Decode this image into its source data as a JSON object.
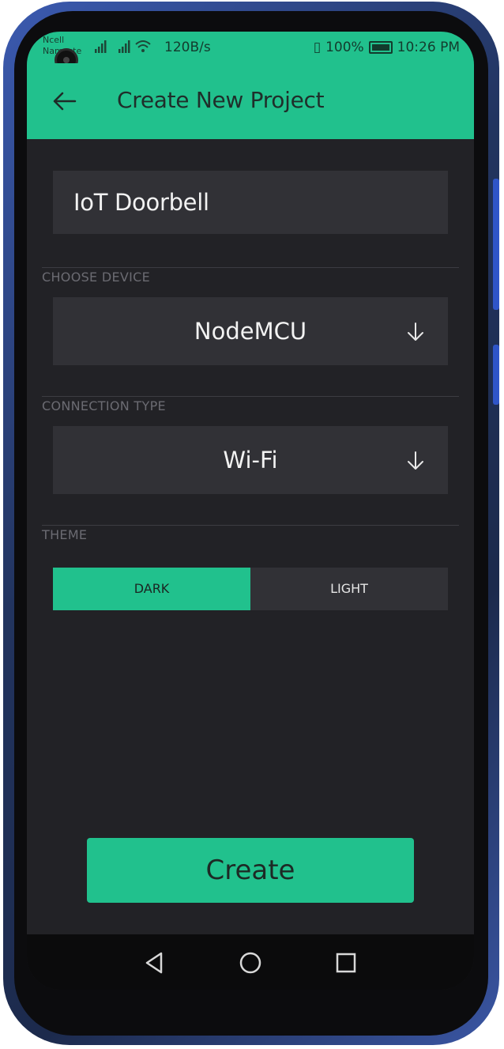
{
  "status_bar": {
    "carrier_line1": "Ncell",
    "carrier_line2": "Namaste",
    "net_speed": "120B/s",
    "battery": "100%",
    "time": "10:26 PM"
  },
  "app_bar": {
    "title": "Create New Project"
  },
  "form": {
    "project_name": "IoT Doorbell",
    "device_label": "CHOOSE DEVICE",
    "device_value": "NodeMCU",
    "connection_label": "CONNECTION TYPE",
    "connection_value": "Wi-Fi",
    "theme_label": "THEME",
    "theme_options": [
      "DARK",
      "LIGHT"
    ],
    "theme_selected": "DARK"
  },
  "create_label": "Create",
  "colors": {
    "accent": "#21c18d",
    "background": "#222226",
    "field": "#313136"
  },
  "icons": {
    "back": "arrow-left-icon",
    "dropdown": "arrow-down-icon",
    "nav": [
      "back-triangle-icon",
      "home-circle-icon",
      "recents-square-icon"
    ]
  }
}
